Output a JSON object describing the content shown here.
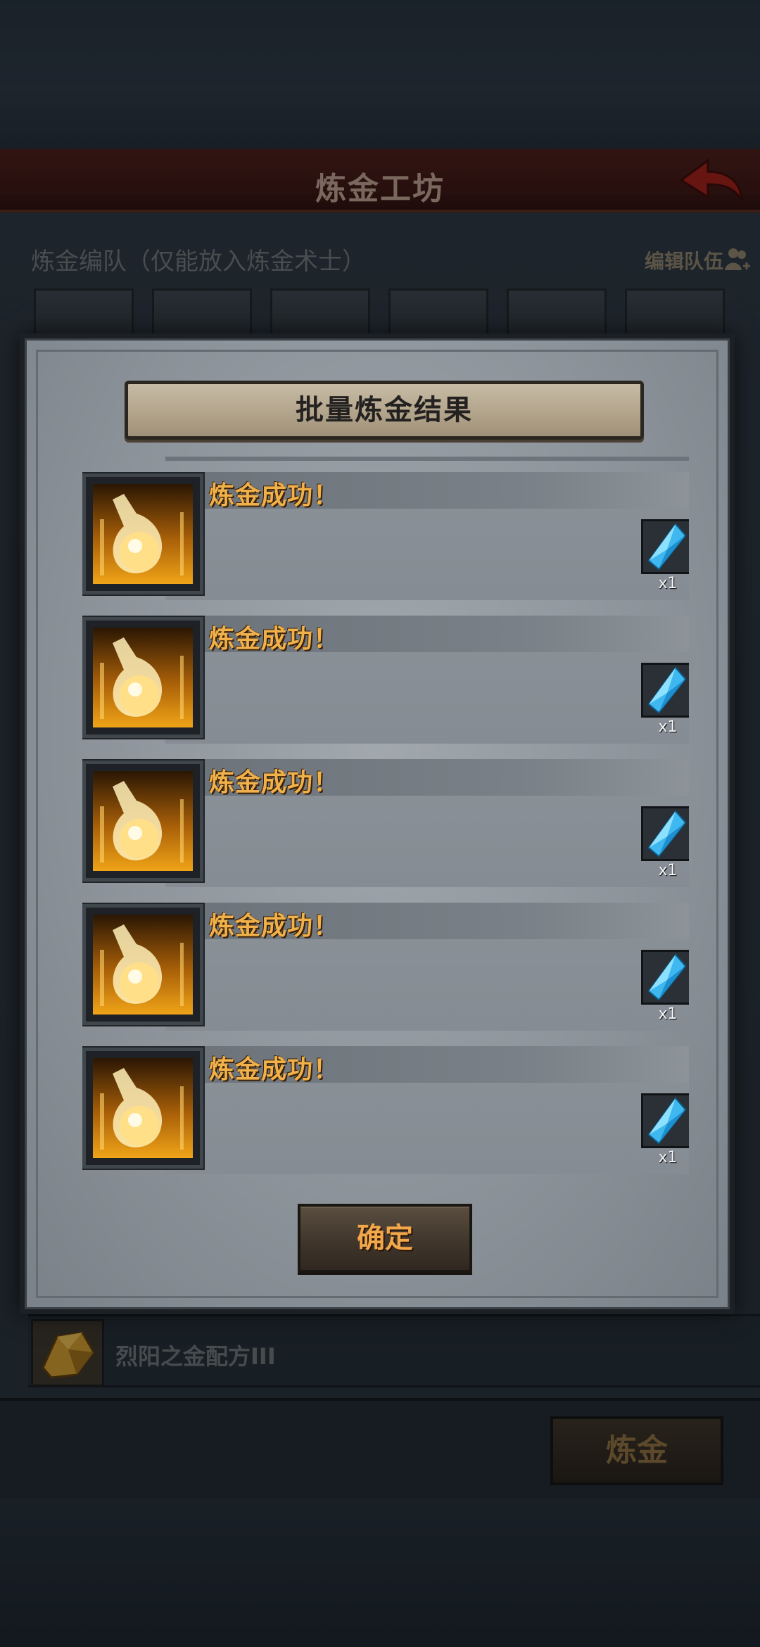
{
  "header": {
    "title": "炼金工坊"
  },
  "team": {
    "label": "炼金编队（仅能放入炼金术士）",
    "edit_label": "编辑队伍"
  },
  "recipe": {
    "name": "烈阳之金配方III"
  },
  "action": {
    "alchemy_label": "炼金"
  },
  "dialog": {
    "title": "批量炼金结果",
    "results": [
      {
        "status": "炼金成功！",
        "reward_item": "blue-crystal",
        "reward_count": "x1"
      },
      {
        "status": "炼金成功！",
        "reward_item": "blue-crystal",
        "reward_count": "x1"
      },
      {
        "status": "炼金成功！",
        "reward_item": "blue-crystal",
        "reward_count": "x1"
      },
      {
        "status": "炼金成功！",
        "reward_item": "blue-crystal",
        "reward_count": "x1"
      },
      {
        "status": "炼金成功！",
        "reward_item": "blue-crystal",
        "reward_count": "x1"
      }
    ],
    "confirm_label": "确定"
  },
  "colors": {
    "accent_gold": "#f0b14a",
    "title_red": "#4a1c16",
    "crystal_blue": "#3fb8f0"
  }
}
